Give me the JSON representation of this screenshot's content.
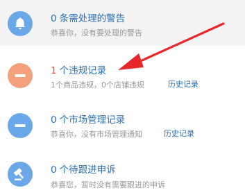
{
  "colors": {
    "blue": "#6aa8e8",
    "orange": "#f5a07c",
    "link": "#2a6fb6",
    "red_count": "#e84c3d",
    "arrow_red": "#e8272b",
    "sub_text": "#999999"
  },
  "items": [
    {
      "icon": "bell-icon",
      "count": "0",
      "title": "条需处理的警告",
      "sub": "恭喜你，没有要处理的警告"
    },
    {
      "icon": "minus-circle-icon",
      "count": "1",
      "title": "个违规记录",
      "sub": "1个商品违规，0个店铺违规",
      "link": "历史记录"
    },
    {
      "icon": "minus-circle-icon",
      "count": "0",
      "title": "个市场管理记录",
      "sub": "恭喜你，没有市场管理通知",
      "link": "历史记录"
    },
    {
      "icon": "gavel-icon",
      "count": "0",
      "title": "个待跟进申诉",
      "sub": "恭喜您，暂时没有需要跟进的申诉"
    }
  ]
}
